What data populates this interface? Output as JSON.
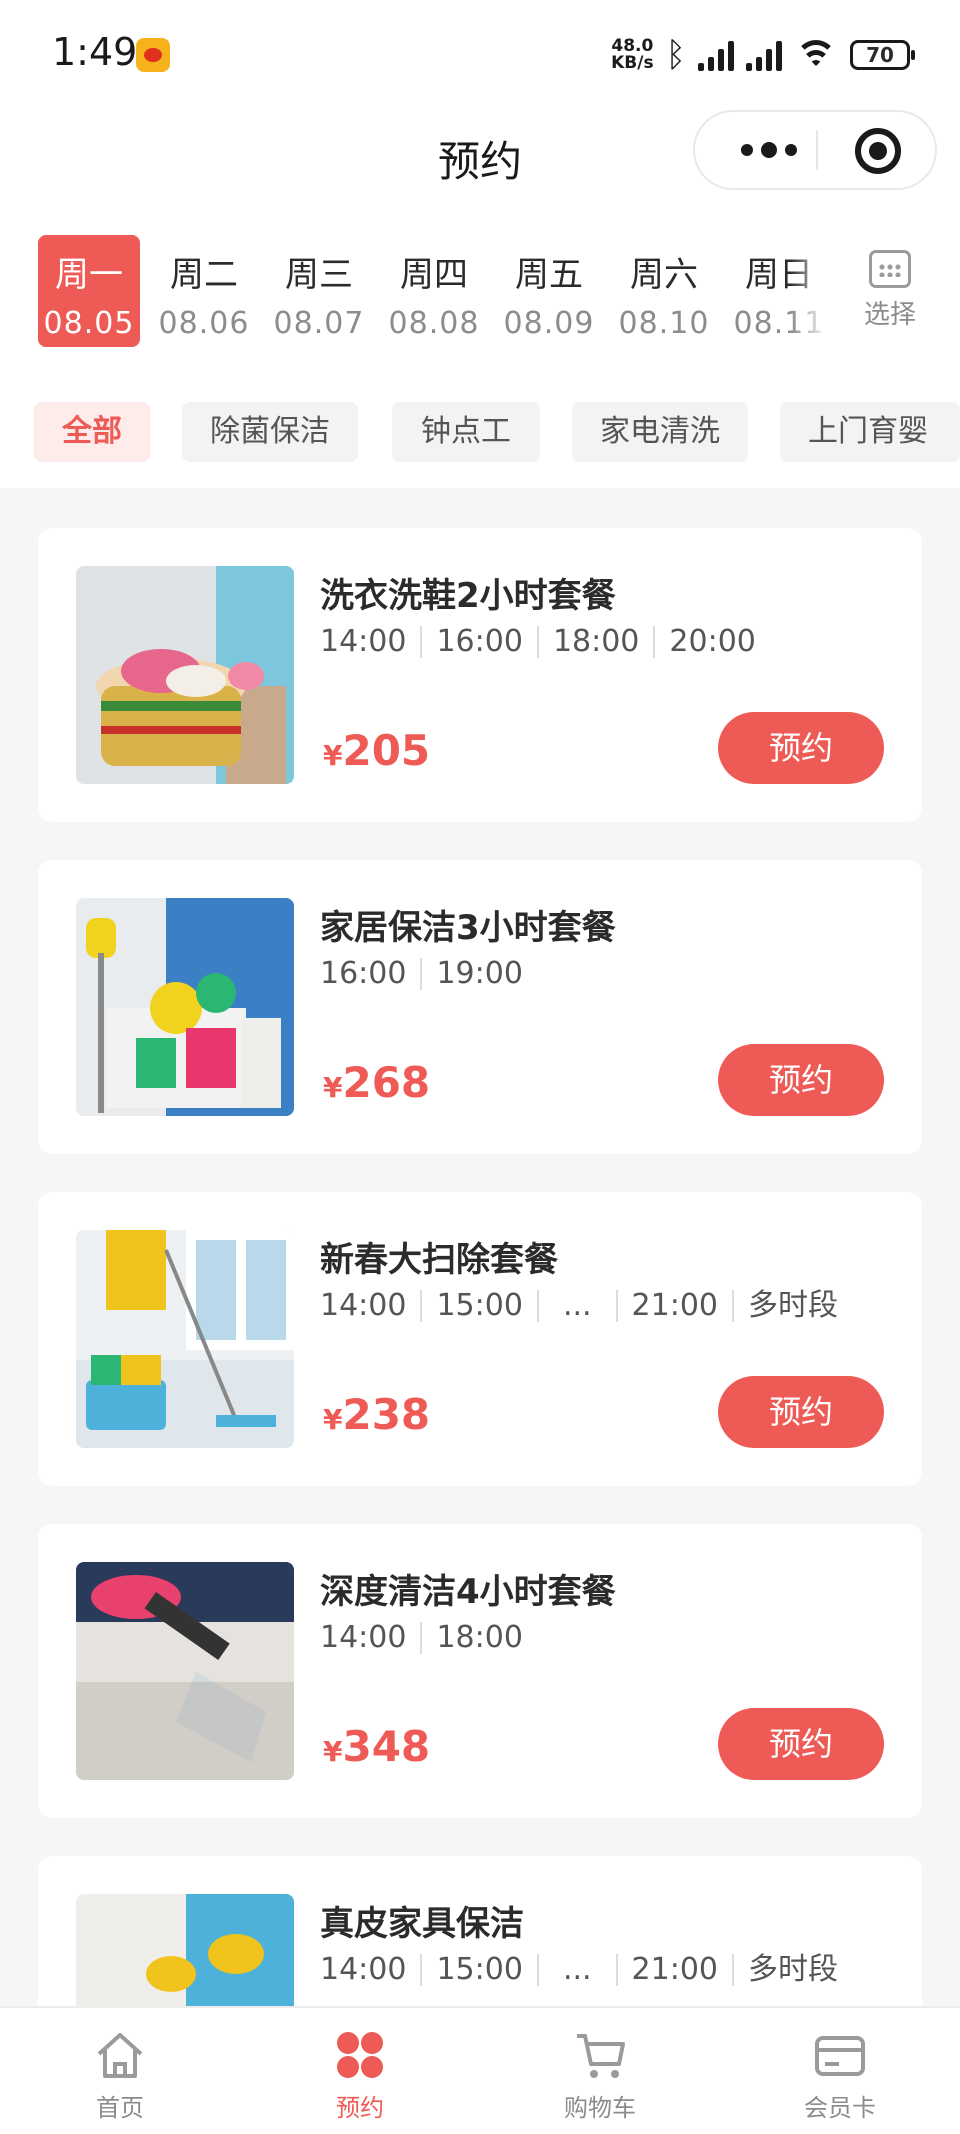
{
  "status_bar": {
    "time": "1:49",
    "net_speed_value": "48.0",
    "net_speed_unit": "KB/s",
    "battery": "70"
  },
  "nav": {
    "title": "预约"
  },
  "dates": [
    {
      "day": "周一",
      "date": "08.05",
      "active": true
    },
    {
      "day": "周二",
      "date": "08.06"
    },
    {
      "day": "周三",
      "date": "08.07"
    },
    {
      "day": "周四",
      "date": "08.08"
    },
    {
      "day": "周五",
      "date": "08.09"
    },
    {
      "day": "周六",
      "date": "08.10"
    },
    {
      "day": "周日",
      "date": "08.11"
    }
  ],
  "calendar_label": "选择",
  "categories": [
    "全部",
    "除菌保洁",
    "钟点工",
    "家电清洗",
    "上门育婴"
  ],
  "services": [
    {
      "title": "洗衣洗鞋2小时套餐",
      "slots": [
        "14:00",
        "16:00",
        "18:00",
        "20:00"
      ],
      "currency": "¥",
      "price": "205",
      "button": "预约"
    },
    {
      "title": "家居保洁3小时套餐",
      "slots": [
        "16:00",
        "19:00"
      ],
      "currency": "¥",
      "price": "268",
      "button": "预约"
    },
    {
      "title": "新春大扫除套餐",
      "slots": [
        "14:00",
        "15:00",
        "...",
        "21:00",
        "多时段"
      ],
      "currency": "¥",
      "price": "238",
      "button": "预约"
    },
    {
      "title": "深度清洁4小时套餐",
      "slots": [
        "14:00",
        "18:00"
      ],
      "currency": "¥",
      "price": "348",
      "button": "预约"
    },
    {
      "title": "真皮家具保洁",
      "slots": [
        "14:00",
        "15:00",
        "...",
        "21:00",
        "多时段"
      ],
      "currency": "¥",
      "price": "",
      "button": ""
    }
  ],
  "tabs": [
    {
      "label": "首页",
      "icon": "home-icon"
    },
    {
      "label": "预约",
      "icon": "booking-icon",
      "active": true
    },
    {
      "label": "购物车",
      "icon": "cart-icon"
    },
    {
      "label": "会员卡",
      "icon": "member-card-icon"
    }
  ],
  "colors": {
    "accent": "#ee5a55",
    "accent_light": "#fdecea",
    "background": "#f6f6f6"
  }
}
